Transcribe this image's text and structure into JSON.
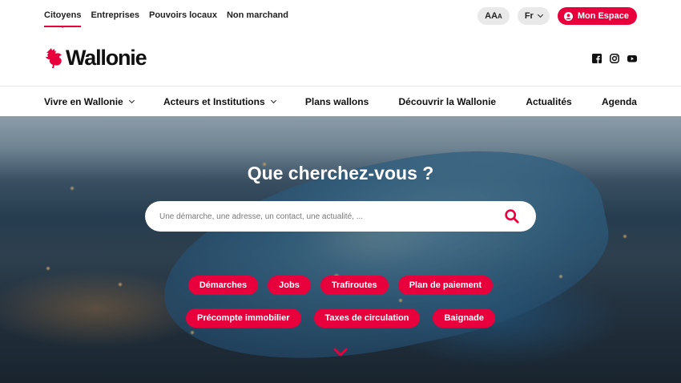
{
  "header": {
    "audiences": [
      "Citoyens",
      "Entreprises",
      "Pouvoirs locaux",
      "Non marchand"
    ],
    "text_size_label": "AA",
    "text_size_small": "A",
    "language": "Fr",
    "account_label": "Mon Espace"
  },
  "brand": {
    "name": "Wallonie",
    "social": [
      "facebook-icon",
      "instagram-icon",
      "youtube-icon"
    ]
  },
  "nav": {
    "items": [
      {
        "label": "Vivre en Wallonie",
        "dropdown": true
      },
      {
        "label": "Acteurs et Institutions",
        "dropdown": true
      },
      {
        "label": "Plans wallons",
        "dropdown": false
      },
      {
        "label": "Découvrir la Wallonie",
        "dropdown": false
      },
      {
        "label": "Actualités",
        "dropdown": false
      },
      {
        "label": "Agenda",
        "dropdown": false
      }
    ]
  },
  "hero": {
    "title": "Que cherchez-vous ?",
    "search_placeholder": "Une démarche, une adresse, un contact, une actualité, ...",
    "quick_links_row1": [
      "Démarches",
      "Jobs",
      "Trafiroutes",
      "Plan de paiement"
    ],
    "quick_links_row2": [
      "Précompte immobilier",
      "Taxes de circulation",
      "Baignade"
    ]
  },
  "colors": {
    "accent": "#e8003d",
    "text": "#111111",
    "pill_bg": "#e9e9e9"
  }
}
